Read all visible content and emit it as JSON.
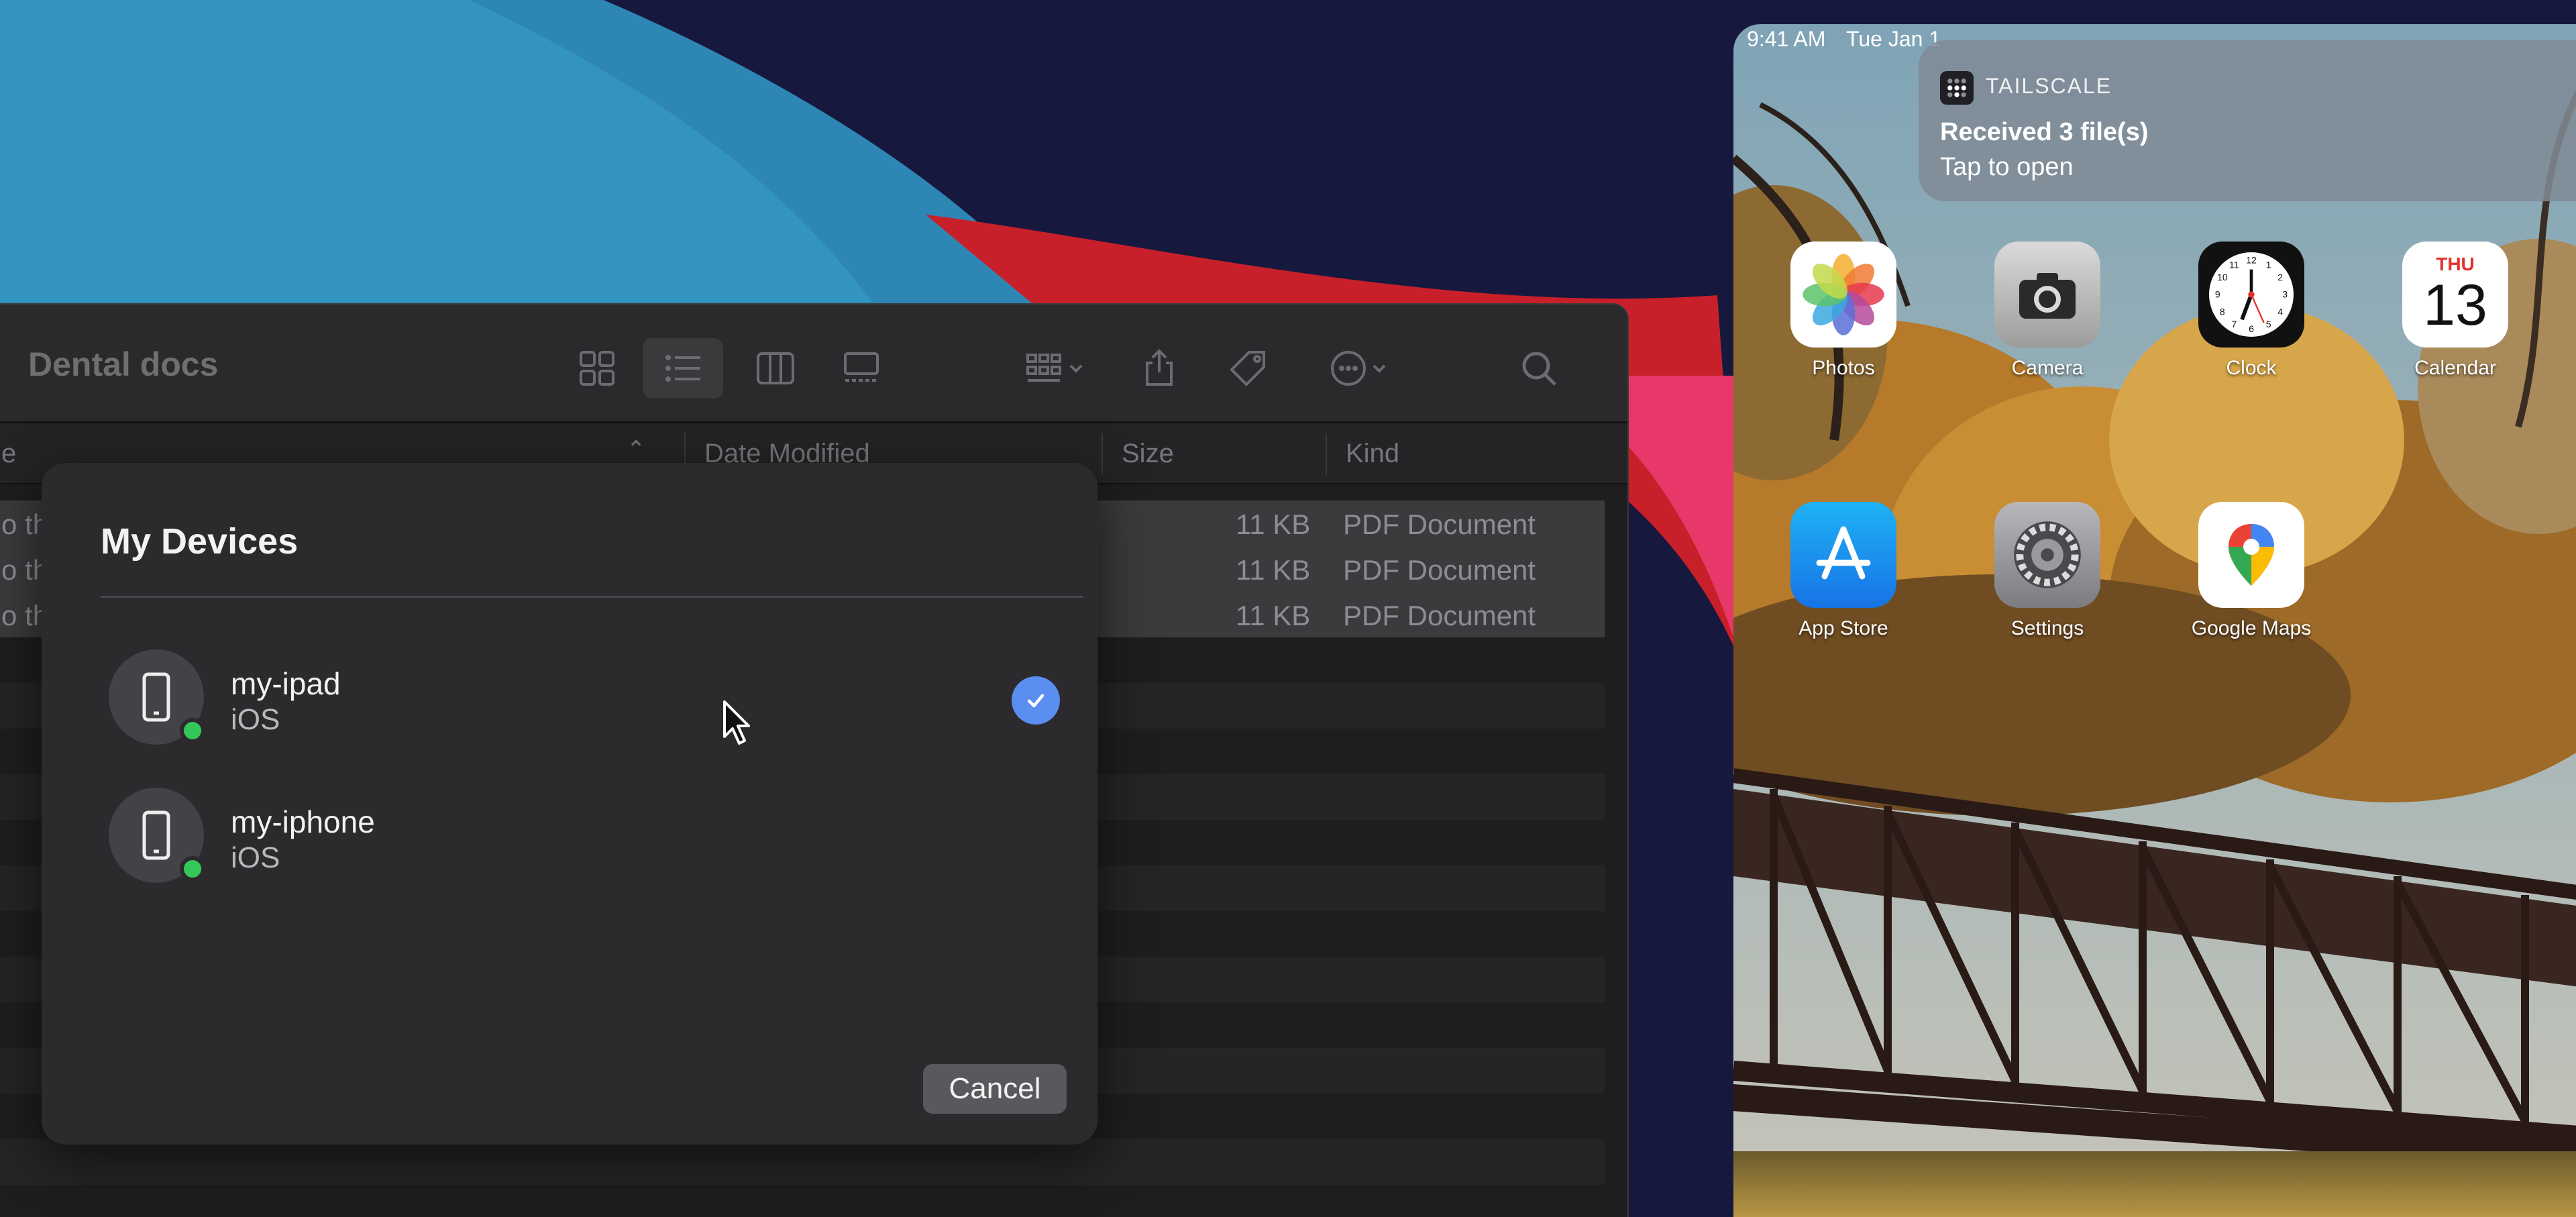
{
  "finder": {
    "title": "Dental docs",
    "columns": {
      "name": "e",
      "date_modified": "Date Modified",
      "size": "Size",
      "kind": "Kind"
    },
    "rows": [
      {
        "name": "o th",
        "size": "11 KB",
        "kind": "PDF Document"
      },
      {
        "name": "o th",
        "size": "11 KB",
        "kind": "PDF Document"
      },
      {
        "name": "o th",
        "size": "11 KB",
        "kind": "PDF Document"
      }
    ],
    "toolbar_icons": [
      "icon-view-icon",
      "list-view-icon",
      "column-view-icon",
      "gallery-view-icon",
      "group-icon",
      "share-icon",
      "tag-icon",
      "more-icon",
      "search-icon"
    ]
  },
  "sheet": {
    "title": "My Devices",
    "devices": [
      {
        "name": "my-ipad",
        "os": "iOS",
        "online": true,
        "selected": true
      },
      {
        "name": "my-iphone",
        "os": "iOS",
        "online": true,
        "selected": false
      }
    ],
    "cancel_label": "Cancel"
  },
  "ipad": {
    "status": {
      "time": "9:41 AM",
      "date": "Tue Jan 1"
    },
    "notification": {
      "app": "TAILSCALE",
      "title": "Received 3 file(s)",
      "subtitle": "Tap to open"
    },
    "apps": [
      {
        "label": "Photos",
        "icon": "photos-icon"
      },
      {
        "label": "Camera",
        "icon": "camera-icon"
      },
      {
        "label": "Clock",
        "icon": "clock-icon"
      },
      {
        "label": "Calendar",
        "icon": "calendar-icon",
        "day": "THU",
        "date": "13"
      },
      {
        "label": "App Store",
        "icon": "app-store-icon"
      },
      {
        "label": "Settings",
        "icon": "settings-icon"
      },
      {
        "label": "Google Maps",
        "icon": "google-maps-icon"
      }
    ]
  },
  "colors": {
    "accent": "#5a8ef0",
    "online": "#34c759",
    "calendar_red": "#e5302a"
  }
}
